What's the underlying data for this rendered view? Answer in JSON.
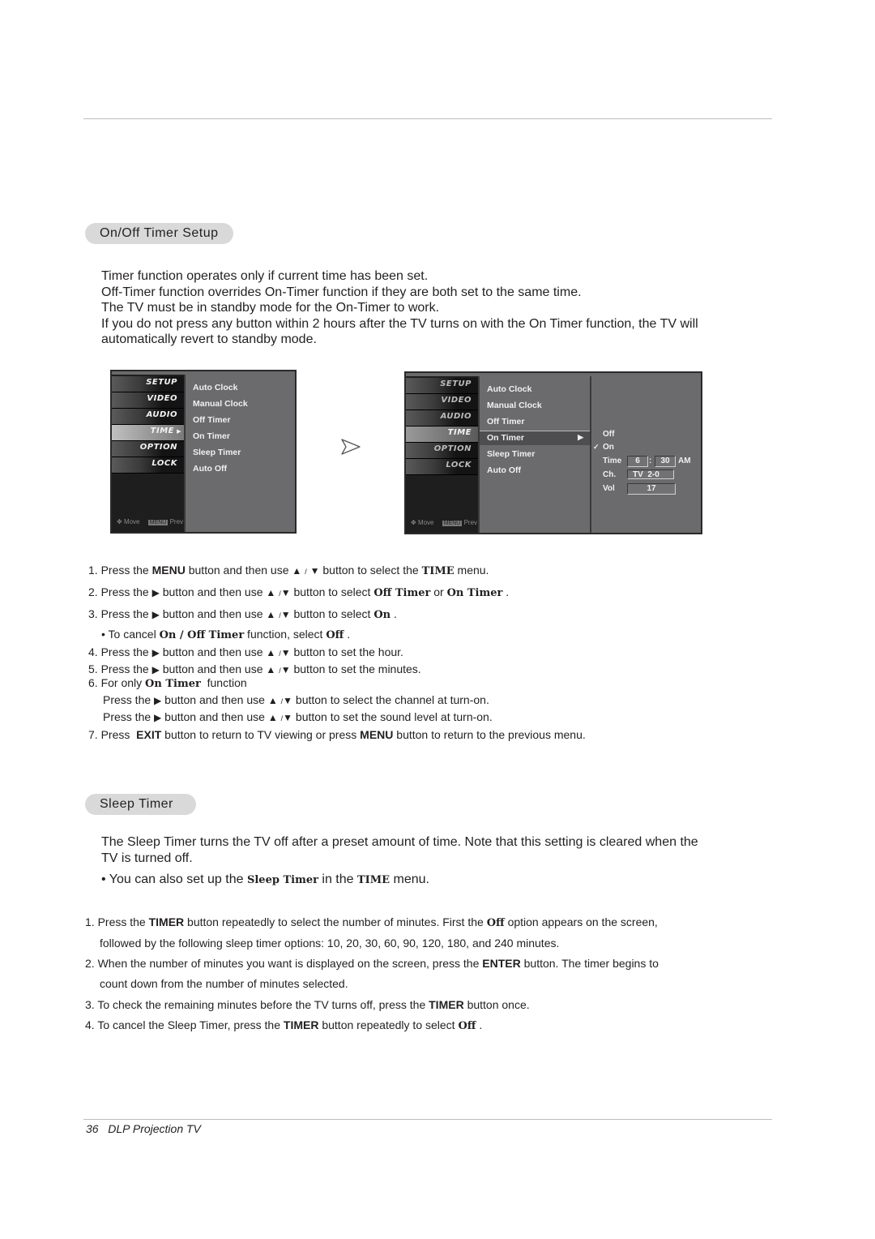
{
  "section1": {
    "title": "On/Off Timer Setup",
    "intro": [
      "Timer function operates only if current time has been set.",
      "Off-Timer function overrides On-Timer function if they are both set to the same time.",
      "The TV must be in standby mode for the On-Timer to work.",
      "If you do not press any button within 2 hours after the TV turns on with the On Timer function, the TV will automatically revert to standby mode."
    ],
    "osd_left": {
      "tabs": [
        "SETUP",
        "VIDEO",
        "AUDIO",
        "TIME",
        "OPTION",
        "LOCK"
      ],
      "active_tab": "TIME",
      "menu_items": [
        "Auto Clock",
        "Manual Clock",
        "Off Timer",
        "On Timer",
        "Sleep Timer",
        "Auto Off"
      ],
      "footer_move": "Move",
      "footer_menu_key": "MENU",
      "footer_prev": "Prev"
    },
    "osd_right": {
      "tabs": [
        "SETUP",
        "VIDEO",
        "AUDIO",
        "TIME",
        "OPTION",
        "LOCK"
      ],
      "active_tab": "TIME",
      "menu_items": [
        "Auto Clock",
        "Manual Clock",
        "Off Timer",
        "On Timer",
        "Sleep Timer",
        "Auto Off"
      ],
      "selected_item": "On Timer",
      "submenu": {
        "off_label": "Off",
        "on_label": "On",
        "checked": "On",
        "time_label": "Time",
        "hour": "6",
        "colon": ":",
        "minute": "30",
        "ampm": "AM",
        "ch_label": "Ch.",
        "channel": "TV  2-0",
        "vol_label": "Vol",
        "volume": "17"
      },
      "footer_move": "Move",
      "footer_menu_key": "MENU",
      "footer_prev": "Prev"
    },
    "steps": {
      "s1": {
        "num": "1.",
        "a": "Press the ",
        "b": "MENU",
        "c": " button and then use ",
        "d": " button to select the ",
        "e": "TIME",
        "f": " menu."
      },
      "s2": {
        "num": "2.",
        "a": "Press the ",
        "c": " button and then use ",
        "d": " button to select ",
        "e": "Off Timer",
        "f": " or ",
        "g": "On Timer",
        "h": " ."
      },
      "s3": {
        "num": "3.",
        "a": "Press the ",
        "c": " button and then use ",
        "d": " button to select ",
        "e": "On",
        "f": " ."
      },
      "s3_note": {
        "a": "• To cancel ",
        "b": "On / Off Timer",
        "c": " function, select ",
        "d": "Off",
        "e": " ."
      },
      "s4": {
        "num": "4.",
        "a": "Press the ",
        "c": " button and then use ",
        "d": " button to set the hour."
      },
      "s5": {
        "num": "5.",
        "a": "Press the ",
        "c": " button and then use ",
        "d": " button to set the minutes."
      },
      "s6": {
        "num": "6.",
        "a": "For only ",
        "b": "On Timer",
        "c": "  function"
      },
      "s6a": {
        "a": "Press the ",
        "c": " button and then use ",
        "d": " button to select the channel at turn-on."
      },
      "s6b": {
        "a": "Press the ",
        "c": " button and then use ",
        "d": " button to set the sound level at turn-on."
      },
      "s7": {
        "num": "7.",
        "a": "Press  ",
        "b": "EXIT",
        "c": " button to return to TV viewing or press ",
        "d": "MENU",
        "e": " button to return to the previous menu."
      }
    },
    "glyphs": {
      "up": "▲",
      "slash": "/",
      "down": "▼",
      "right": "▶"
    }
  },
  "section2": {
    "title": "Sleep Timer",
    "intro": "The Sleep Timer turns the TV off after a preset amount of time. Note that this setting is cleared when the TV is turned off.",
    "note": {
      "a": "• You can also set up the ",
      "b": "Sleep Timer",
      "c": " in the ",
      "d": "TIME",
      "e": " menu."
    },
    "steps": {
      "s1": {
        "a": "1. Press the ",
        "b": "TIMER",
        "c": " button repeatedly to select the number of minutes. First the ",
        "d": "Off",
        "e": " option appears on the screen,",
        "f": "followed by the following sleep timer options: 10, 20, 30, 60, 90, 120, 180, and 240 minutes."
      },
      "s2": {
        "a": "2. When the number of minutes you want is displayed on the screen, press the ",
        "b": "ENTER",
        "c": " button. The timer begins to",
        "d": "count down from the number of minutes selected."
      },
      "s3": {
        "a": "3. To check the remaining minutes before the TV turns off, press the ",
        "b": "TIMER",
        "c": " button once."
      },
      "s4": {
        "a": "4. To cancel the Sleep Timer, press the ",
        "b": "TIMER",
        "c": " button repeatedly to select ",
        "d": "Off",
        "e": " ."
      }
    }
  },
  "footer": {
    "page": "36",
    "title": "DLP Projection TV"
  }
}
